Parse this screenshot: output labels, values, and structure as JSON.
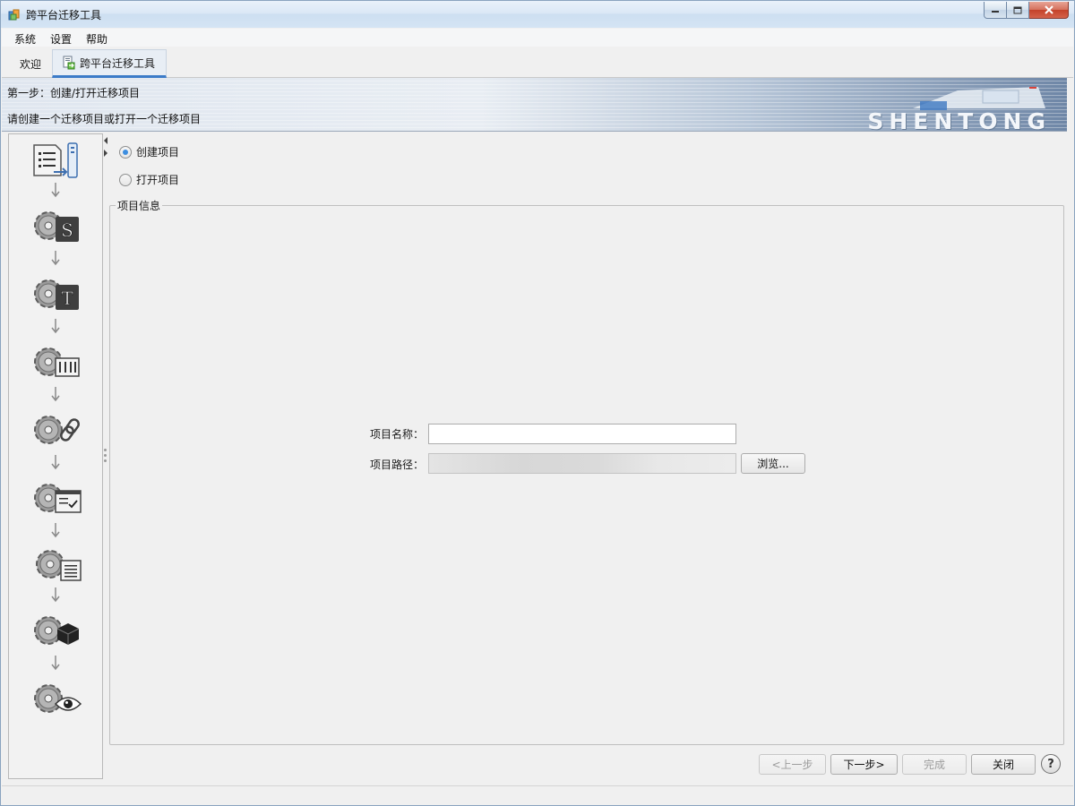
{
  "window": {
    "title": "跨平台迁移工具",
    "controls": {
      "minimize": "minimize",
      "maximize": "maximize",
      "close": "close"
    }
  },
  "menu": {
    "items": [
      "系统",
      "设置",
      "帮助"
    ]
  },
  "tabs": {
    "welcome": "欢迎",
    "active": "跨平台迁移工具"
  },
  "banner": {
    "step": "第一步：创建/打开迁移项目",
    "description": "请创建一个迁移项目或打开一个迁移项目",
    "brand": "SHENTONG"
  },
  "options": {
    "create_label": "创建项目",
    "open_label": "打开项目",
    "selected": "create"
  },
  "group": {
    "title": "项目信息",
    "name_label": "项目名称：",
    "name_value": "",
    "path_label": "项目路径：",
    "path_value": "",
    "browse_label": "浏览..."
  },
  "footer": {
    "prev_label": "<上一步",
    "next_label": "下一步>",
    "finish_label": "完成",
    "close_label": "关闭",
    "help_label": "?"
  },
  "rail": {
    "steps": [
      {
        "icon": "document-server-icon"
      },
      {
        "icon": "gear-source-icon",
        "letter": "S"
      },
      {
        "icon": "gear-target-icon",
        "letter": "T"
      },
      {
        "icon": "gear-mapping-icon"
      },
      {
        "icon": "gear-link-icon"
      },
      {
        "icon": "gear-window-check-icon"
      },
      {
        "icon": "gear-list-icon"
      },
      {
        "icon": "gear-cube-icon"
      },
      {
        "icon": "gear-eye-icon"
      }
    ]
  },
  "colors": {
    "accent": "#3b7bc8",
    "radio_dot": "#3d8ee0",
    "titlebar": "#dbe8f6",
    "close_button": "#c4422a"
  }
}
